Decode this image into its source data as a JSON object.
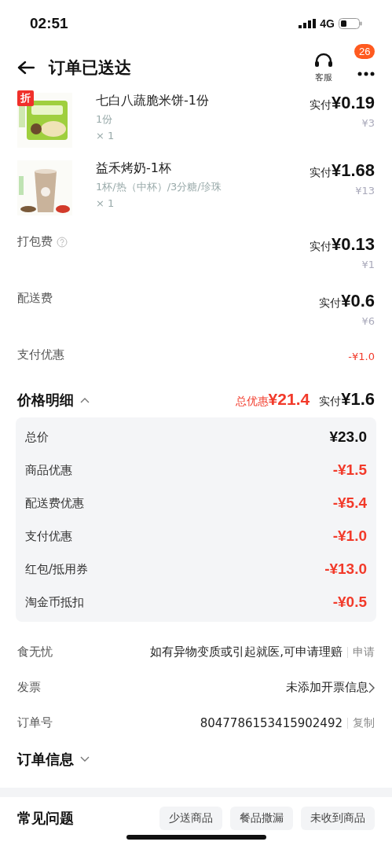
{
  "status_bar": {
    "time": "02:51",
    "network": "4G"
  },
  "header": {
    "title": "订单已送达",
    "service_label": "客服",
    "badge": "26"
  },
  "items": [
    {
      "name": "七白八蔬脆米饼-1份",
      "spec": "1份",
      "qty": "× 1",
      "paid_label": "实付",
      "paid": "¥0.19",
      "original": "¥3",
      "tag": "折"
    },
    {
      "name": "益禾烤奶-1杯",
      "spec": "1杯/热（中杯）/3分糖/珍珠",
      "qty": "× 1",
      "paid_label": "实付",
      "paid": "¥1.68",
      "original": "¥13"
    }
  ],
  "fees": [
    {
      "kind": "fee",
      "label": "打包费",
      "help": true,
      "paid_label": "实付",
      "paid": "¥0.13",
      "original": "¥1"
    },
    {
      "kind": "fee",
      "label": "配送费",
      "help": false,
      "paid_label": "实付",
      "paid": "¥0.6",
      "original": "¥6"
    },
    {
      "kind": "discount",
      "label": "支付优惠",
      "value": "-¥1.0"
    }
  ],
  "price_details": {
    "title": "价格明细",
    "expanded": true,
    "discount_label": "总优惠",
    "discount": "¥21.4",
    "paid_label": "实付",
    "paid": "¥1.6",
    "rows": [
      {
        "label": "总价",
        "value": "¥23.0",
        "kind": "total"
      },
      {
        "label": "商品优惠",
        "value": "-¥1.5",
        "kind": "discount"
      },
      {
        "label": "配送费优惠",
        "value": "-¥5.4",
        "kind": "discount"
      },
      {
        "label": "支付优惠",
        "value": "-¥1.0",
        "kind": "discount"
      },
      {
        "label": "红包/抵用券",
        "value": "-¥13.0",
        "kind": "discount"
      },
      {
        "label": "淘金币抵扣",
        "value": "-¥0.5",
        "kind": "discount"
      }
    ]
  },
  "info_rows": [
    {
      "label": "食无忧",
      "value": "如有异物变质或引起就医,可申请理赔",
      "action": "申请",
      "kind": "action"
    },
    {
      "label": "发票",
      "value": "未添加开票信息",
      "kind": "link"
    },
    {
      "label": "订单号",
      "value": "8047786153415902492",
      "action": "复制",
      "kind": "action"
    }
  ],
  "order_info": {
    "title": "订单信息",
    "expanded": false
  },
  "faq": {
    "title": "常见问题",
    "chips": [
      "少送商品",
      "餐品撒漏",
      "未收到商品"
    ]
  }
}
